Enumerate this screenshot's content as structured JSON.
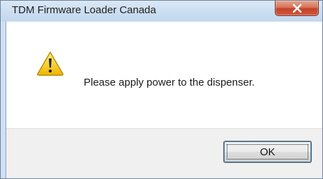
{
  "window": {
    "title": "TDM Firmware Loader Canada"
  },
  "dialog": {
    "icon": "warning-icon",
    "message": "Please apply power to the dispenser."
  },
  "buttons": {
    "ok_label": "OK",
    "close_icon": "close-icon"
  },
  "colors": {
    "titlebar": "#cddff1",
    "close_button": "#c0442a",
    "button_bar": "#f0f0f0",
    "warning": "#f5c400"
  }
}
